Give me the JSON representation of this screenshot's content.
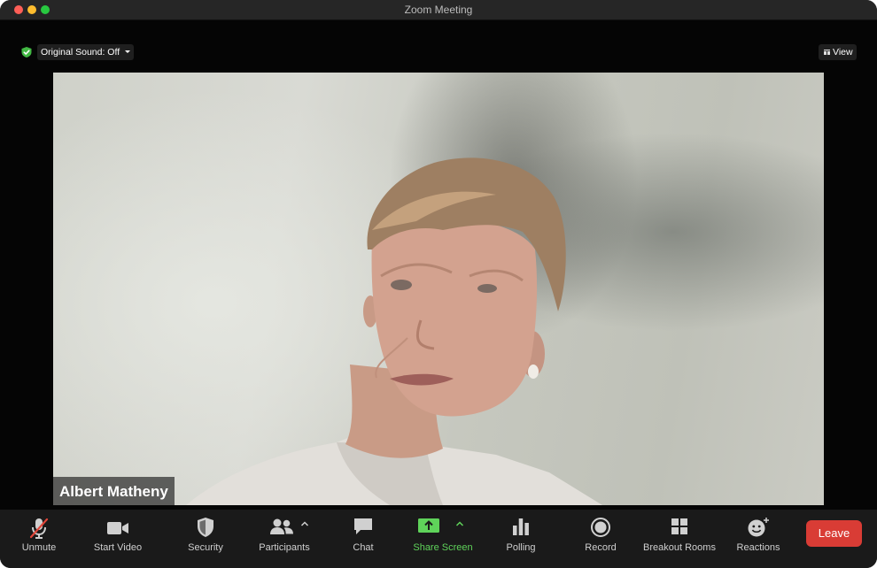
{
  "window": {
    "title": "Zoom Meeting"
  },
  "top": {
    "sound_label": "Original Sound: Off",
    "view_label": "View"
  },
  "video": {
    "participant_name": "Albert Matheny"
  },
  "toolbar": {
    "unmute": "Unmute",
    "start_video": "Start Video",
    "security": "Security",
    "participants": "Participants",
    "chat": "Chat",
    "share_screen": "Share Screen",
    "polling": "Polling",
    "record": "Record",
    "breakout_rooms": "Breakout Rooms",
    "reactions": "Reactions",
    "leave": "Leave"
  },
  "colors": {
    "accent_green": "#5fd35a",
    "leave_red": "#d93c35",
    "muted_red": "#e0463a"
  }
}
